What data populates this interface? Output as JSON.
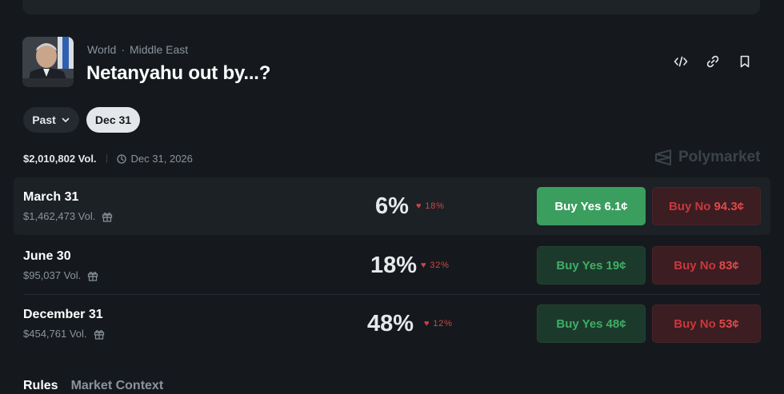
{
  "header": {
    "category": "World",
    "subcategory": "Middle East",
    "title": "Netanyahu out by...?"
  },
  "toolbar": {
    "embed_icon": "code-icon",
    "link_icon": "link-icon",
    "bookmark_icon": "bookmark-icon"
  },
  "filters": {
    "past_label": "Past",
    "active_date_label": "Dec 31"
  },
  "summary": {
    "volume": "$2,010,802 Vol.",
    "end_date": "Dec 31, 2026"
  },
  "brand": {
    "name": "Polymarket"
  },
  "markets": [
    {
      "name": "March 31",
      "volume": "$1,462,473 Vol.",
      "probability": "6%",
      "change": "18%",
      "yes_label": "Buy Yes",
      "yes_price": "6.1¢",
      "no_label": "Buy No",
      "no_price": "94.3¢",
      "highlighted": true
    },
    {
      "name": "June 30",
      "volume": "$95,037 Vol.",
      "probability": "18%",
      "change": "32%",
      "yes_label": "Buy Yes",
      "yes_price": "19¢",
      "no_label": "Buy No",
      "no_price": "83¢",
      "highlighted": false
    },
    {
      "name": "December 31",
      "volume": "$454,761 Vol.",
      "probability": "48%",
      "change": "12%",
      "yes_label": "Buy Yes",
      "yes_price": "48¢",
      "no_label": "Buy No",
      "no_price": "53¢",
      "highlighted": false
    }
  ],
  "tabs": [
    {
      "label": "Rules"
    },
    {
      "label": "Market Context"
    }
  ],
  "colors": {
    "background": "#15191d",
    "yes_green": "#3a9e5f",
    "no_red": "#c8383c",
    "change_down": "#d04545"
  }
}
